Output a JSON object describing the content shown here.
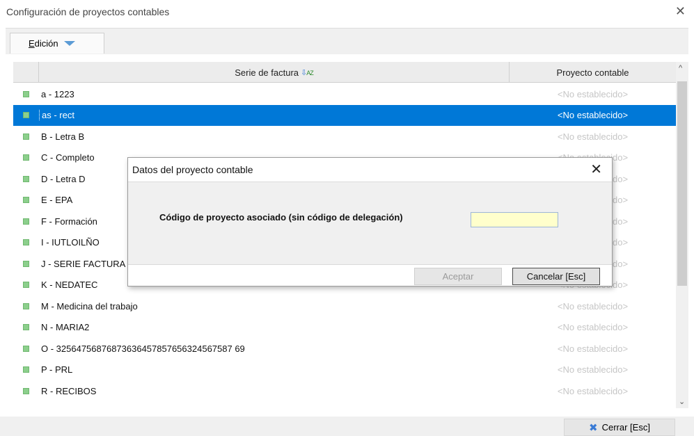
{
  "window": {
    "title": "Configuración de proyectos contables",
    "close_glyph": "✕"
  },
  "toolbar": {
    "menu_label": "Edición"
  },
  "grid": {
    "columns": {
      "serie": "Serie de factura",
      "proyecto": "Proyecto contable"
    },
    "sort_icon": {
      "arrow": "⇩",
      "letters": "AZ"
    },
    "rows": [
      {
        "serie": "a - 1223",
        "proyecto": "<No establecido>",
        "selected": false
      },
      {
        "serie": "as - rect",
        "proyecto": "<No establecido>",
        "selected": true
      },
      {
        "serie": "B - Letra B",
        "proyecto": "<No establecido>",
        "selected": false
      },
      {
        "serie": "C - Completo",
        "proyecto": "<No establecido>",
        "selected": false
      },
      {
        "serie": "D - Letra D",
        "proyecto": "<No establecido>",
        "selected": false
      },
      {
        "serie": "E - EPA",
        "proyecto": "<No establecido>",
        "selected": false
      },
      {
        "serie": "F - Formación",
        "proyecto": "<No establecido>",
        "selected": false
      },
      {
        "serie": "I - IUTLOILÑO",
        "proyecto": "<No establecido>",
        "selected": false
      },
      {
        "serie": "J - SERIE FACTURA",
        "proyecto": "<No establecido>",
        "selected": false
      },
      {
        "serie": "K - NEDATEC",
        "proyecto": "<No establecido>",
        "selected": false
      },
      {
        "serie": "M - Medicina del trabajo",
        "proyecto": "<No establecido>",
        "selected": false
      },
      {
        "serie": "N - MARIA2",
        "proyecto": "<No establecido>",
        "selected": false
      },
      {
        "serie": "O - 32564756876873636457857656324567587 69",
        "proyecto": "<No establecido>",
        "selected": false
      },
      {
        "serie": "P - PRL",
        "proyecto": "<No establecido>",
        "selected": false
      },
      {
        "serie": "R - RECIBOS",
        "proyecto": "<No establecido>",
        "selected": false
      }
    ]
  },
  "scrollbar": {
    "up_glyph": "^",
    "down_glyph": "⌄"
  },
  "footer": {
    "close_label": "Cerrar [Esc]",
    "close_icon": "✖"
  },
  "dialog": {
    "title": "Datos del proyecto contable",
    "close_glyph": "✕",
    "field_label": "Código de proyecto asociado (sin código de delegación)",
    "field_value": "",
    "ok_label": "Aceptar",
    "cancel_label": "Cancelar [Esc]"
  }
}
